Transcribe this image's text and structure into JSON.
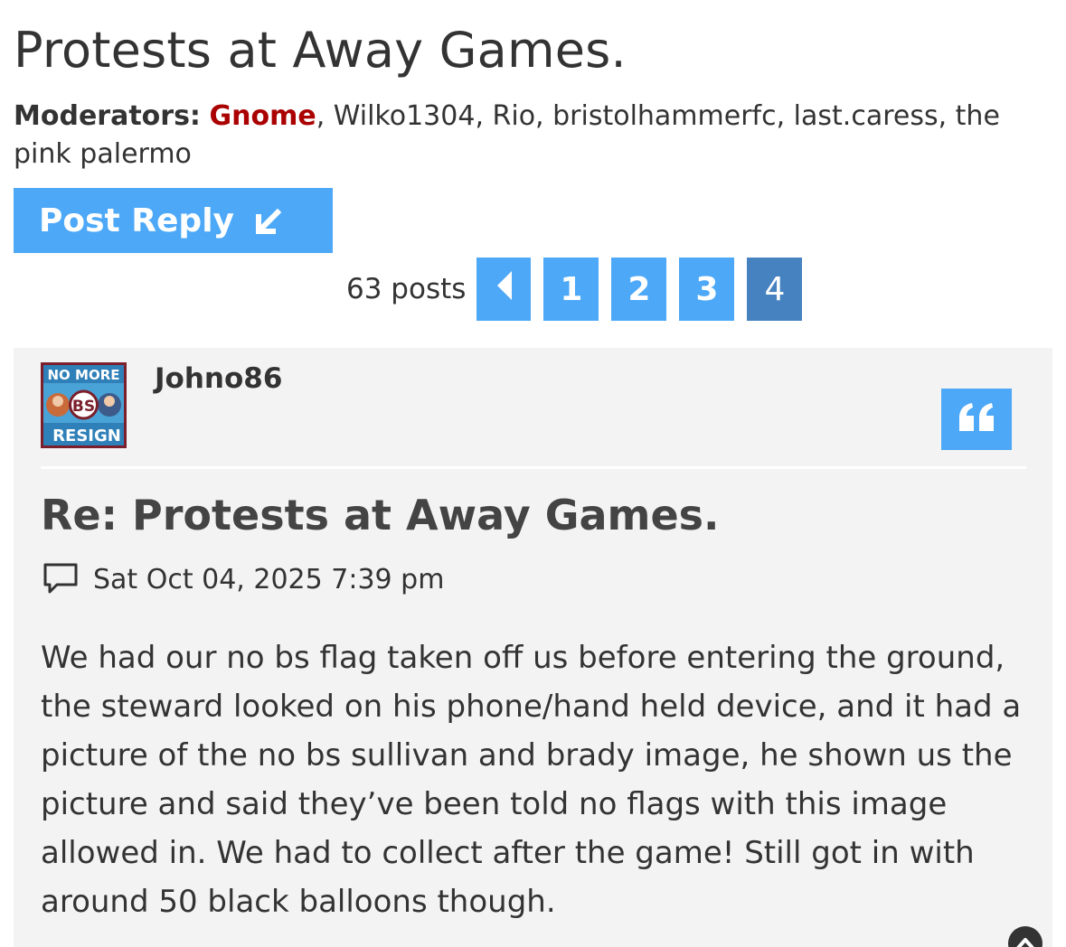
{
  "topic": {
    "title": "Protests at Away Games."
  },
  "moderators": {
    "label": "Moderators:",
    "first": "Gnome",
    "rest": ", Wilko1304, Rio, bristolhammerfc, last.caress, the pink palermo",
    "first_color": "#aa0000"
  },
  "actions": {
    "post_reply_label": "Post Reply"
  },
  "pagination": {
    "post_count": "63 posts",
    "pages": [
      "1",
      "2",
      "3",
      "4"
    ],
    "current_page": "4"
  },
  "post": {
    "avatar": {
      "top_text": "NO MORE",
      "middle_text": "BS",
      "bottom_text": "RESIGN"
    },
    "author": "Johno86",
    "title": "Re: Protests at Away Games.",
    "timestamp": "Sat Oct 04, 2025 7:39 pm",
    "body": "We had our no bs flag taken off us before entering the ground, the steward looked on his phone/hand held device, and it had a picture of the no bs sullivan and brady image, he shown us the picture and said they’ve been told no flags with this image allowed in. We had to collect after the game! Still got in with around 50 black balloons though."
  },
  "colors": {
    "accent": "#4da9f7",
    "current_page": "#4682c0",
    "post_bg": "#f3f3f3"
  },
  "icons": {
    "reply": "reply-arrow-icon",
    "prev": "chevron-left-icon",
    "quote": "quote-icon",
    "post": "speech-bubble-icon",
    "top": "scroll-top-icon"
  }
}
